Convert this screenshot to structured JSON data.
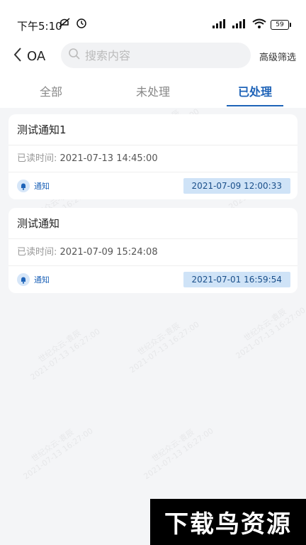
{
  "status_bar": {
    "time": "下午5:10",
    "battery": "59",
    "signal_label": "HD"
  },
  "header": {
    "back_label": "OA",
    "search_placeholder": "搜索内容",
    "filter_label": "高级筛选"
  },
  "tabs": [
    {
      "label": "全部",
      "active": false
    },
    {
      "label": "未处理",
      "active": false
    },
    {
      "label": "已处理",
      "active": true
    }
  ],
  "notices": [
    {
      "title": "测试通知1",
      "read_label": "已读时间:",
      "read_time": "2021-07-13 14:45:00",
      "type_label": "通知",
      "date": "2021-07-09 12:00:33"
    },
    {
      "title": "测试通知",
      "read_label": "已读时间:",
      "read_time": "2021-07-09 15:24:08",
      "type_label": "通知",
      "date": "2021-07-01 16:59:54"
    }
  ],
  "watermark": {
    "line1": "世纪众云-袁辰",
    "line2": "2021-07-13 16:27:00"
  },
  "brand_text": "下载鸟资源",
  "colors": {
    "accent": "#1e63b8",
    "date_tag_bg": "#cfe3f7",
    "page_bg": "#f4f5f7"
  }
}
